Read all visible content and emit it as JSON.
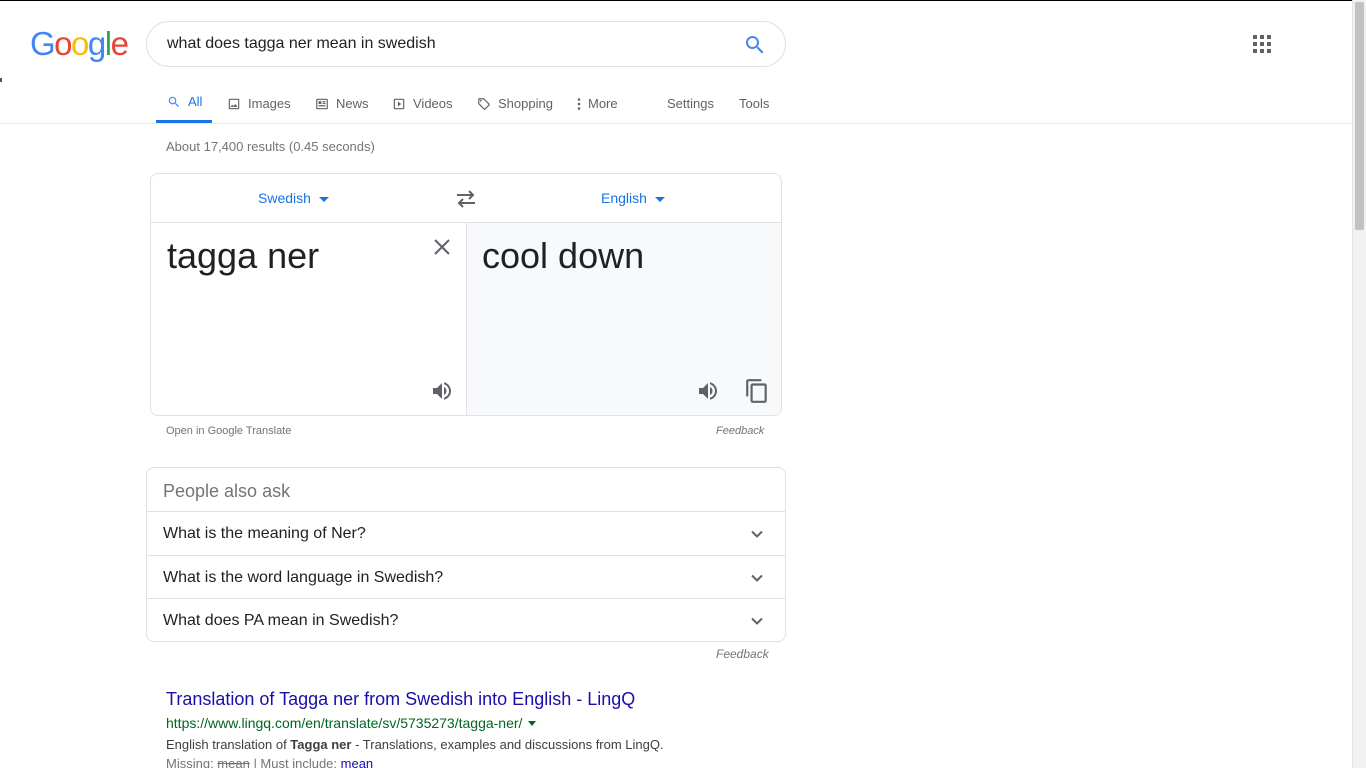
{
  "header": {
    "logo_letters": [
      {
        "ch": "G",
        "color": "#4285f4"
      },
      {
        "ch": "o",
        "color": "#ea4335"
      },
      {
        "ch": "o",
        "color": "#fbbc05"
      },
      {
        "ch": "g",
        "color": "#4285f4"
      },
      {
        "ch": "l",
        "color": "#34a853"
      },
      {
        "ch": "e",
        "color": "#ea4335"
      }
    ],
    "search_query": "what does tagga ner mean in swedish",
    "search_icon": "search-icon",
    "apps_icon": "apps-grid-icon"
  },
  "tabs": {
    "all": "All",
    "images": "Images",
    "news": "News",
    "videos": "Videos",
    "shopping": "Shopping",
    "more": "More",
    "settings": "Settings",
    "tools": "Tools"
  },
  "stats": "About 17,400 results (0.45 seconds)",
  "translate": {
    "source_lang": "Swedish",
    "target_lang": "English",
    "source_text": "tagga ner",
    "target_text": "cool down",
    "open_link": "Open in Google Translate",
    "feedback": "Feedback"
  },
  "paa": {
    "title": "People also ask",
    "questions": [
      "What is the meaning of Ner?",
      "What is the word language in Swedish?",
      "What does PA mean in Swedish?"
    ],
    "feedback": "Feedback"
  },
  "result": {
    "title": "Translation of Tagga ner from Swedish into English - LingQ",
    "url": "https://www.lingq.com/en/translate/sv/5735273/tagga-ner/",
    "snippet_pre": "English translation of ",
    "snippet_bold": "Tagga ner",
    "snippet_post": " - Translations, examples and discussions from LingQ.",
    "missing_label": "Missing: ",
    "missing_word": "mean",
    "must_include_label": " | Must include: ",
    "must_include_word": "mean"
  },
  "colors": {
    "accent_blue": "#1a73e8",
    "link": "#1a0dab",
    "url_green": "#006621"
  }
}
